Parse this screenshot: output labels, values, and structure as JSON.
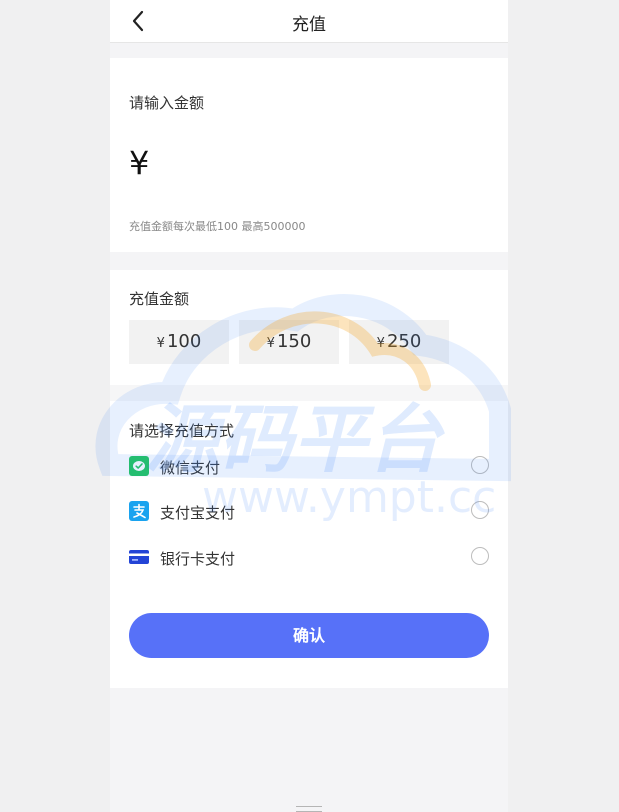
{
  "header": {
    "title": "充值"
  },
  "amount_card": {
    "label": "请输入金额",
    "currency_symbol": "¥",
    "input_value": "",
    "hint": "充值金额每次最低100  最高500000"
  },
  "presets": {
    "label": "充值金额",
    "currency_symbol": "¥",
    "options": [
      "100",
      "150",
      "250"
    ]
  },
  "payment": {
    "label": "请选择充值方式",
    "methods": [
      {
        "label": "微信支付",
        "icon": "wechat-pay-icon",
        "color": "#22c55e"
      },
      {
        "label": "支付宝支付",
        "icon": "alipay-icon",
        "color": "#1aa3ef"
      },
      {
        "label": "银行卡支付",
        "icon": "bank-card-icon",
        "color": "#2344d6"
      }
    ]
  },
  "confirm": {
    "label": "确认"
  },
  "watermark": {
    "title": "源码平台",
    "url": "www.ympt.cc"
  },
  "colors": {
    "primary": "#5771f8",
    "watermark_blue": "#3b82f6",
    "watermark_orange": "#f5a623"
  }
}
